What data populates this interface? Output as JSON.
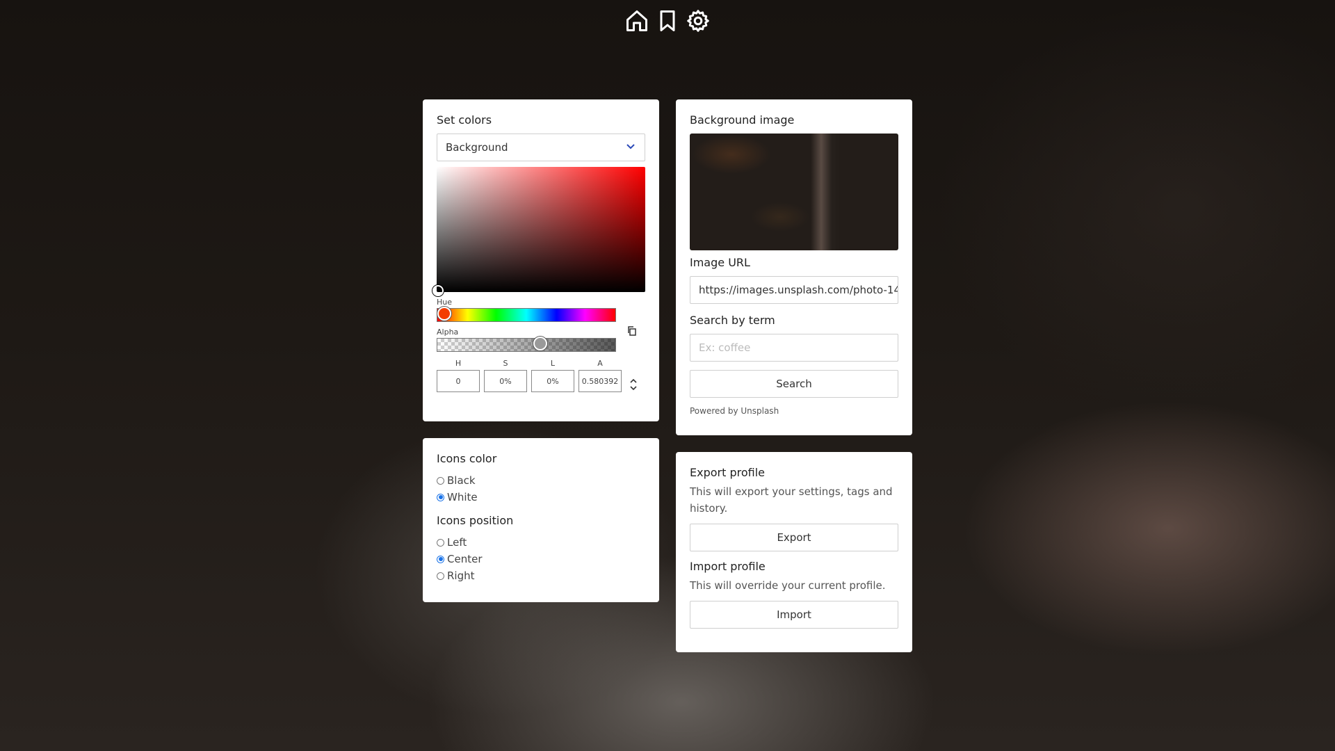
{
  "topbar": {
    "icons": [
      "home-icon",
      "bookmark-icon",
      "gear-icon"
    ],
    "icon_color": "#ffffff"
  },
  "set_colors": {
    "title": "Set colors",
    "target_select": "Background",
    "picker": {
      "hue_label": "Hue",
      "alpha_label": "Alpha",
      "hue_value": 0,
      "alpha_value": 0.580392,
      "fields": [
        {
          "label": "H",
          "value": "0"
        },
        {
          "label": "S",
          "value": "0%"
        },
        {
          "label": "L",
          "value": "0%"
        },
        {
          "label": "A",
          "value": "0.580392"
        }
      ]
    }
  },
  "icons_panel": {
    "color_title": "Icons color",
    "color_options": [
      {
        "label": "Black",
        "checked": false
      },
      {
        "label": "White",
        "checked": true
      }
    ],
    "position_title": "Icons position",
    "position_options": [
      {
        "label": "Left",
        "checked": false
      },
      {
        "label": "Center",
        "checked": true
      },
      {
        "label": "Right",
        "checked": false
      }
    ]
  },
  "background_image": {
    "title": "Background image",
    "url_label": "Image URL",
    "url_value": "https://images.unsplash.com/photo-14",
    "search_label": "Search by term",
    "search_placeholder": "Ex: coffee",
    "search_button": "Search",
    "powered_by": "Powered by Unsplash"
  },
  "profile": {
    "export_title": "Export profile",
    "export_desc": "This will export your settings, tags and history.",
    "export_button": "Export",
    "import_title": "Import profile",
    "import_desc": "This will override your current profile.",
    "import_button": "Import"
  },
  "colors": {
    "accent": "#1a73e8",
    "card": "#ffffff"
  }
}
